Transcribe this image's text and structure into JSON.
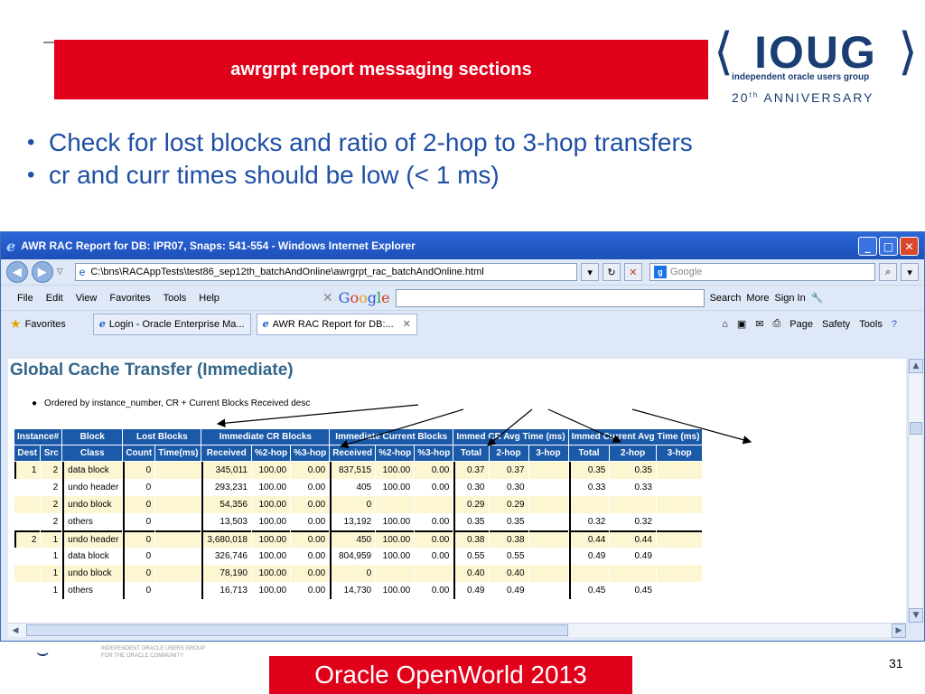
{
  "slide": {
    "title": "awrgrpt report messaging sections",
    "bullets": [
      "Check for lost blocks and ratio of 2-hop to 3-hop transfers",
      "cr and curr times should be low (< 1 ms)"
    ],
    "logo": {
      "wordmark": "IOUG",
      "subtitle": "independent oracle users group",
      "anniversary_num": "20",
      "anniversary_sup": "th",
      "anniversary_word": "ANNIVERSARY"
    },
    "footer_logo_text": [
      "INDEPENDENT ORACLE USERS GROUP",
      "FOR THE ORACLE COMMUNITY"
    ],
    "event_banner": "Oracle OpenWorld 2013",
    "page_number": "31"
  },
  "window": {
    "title": "AWR RAC Report for DB: IPR07, Snaps: 541-554 - Windows Internet Explorer",
    "address": "C:\\bns\\RACAppTests\\test86_sep12th_batchAndOnline\\awrgrpt_rac_batchAndOnline.html",
    "search_placeholder": "Google",
    "menu": [
      "File",
      "Edit",
      "View",
      "Favorites",
      "Tools",
      "Help"
    ],
    "google_toolbar": {
      "search_label": "Search",
      "more_label": "More",
      "signin_label": "Sign In"
    },
    "favorites_label": "Favorites",
    "tabs": [
      {
        "label": "Login - Oracle Enterprise Ma..."
      },
      {
        "label": "AWR RAC Report for DB:..."
      }
    ],
    "commands": [
      "Page",
      "Safety",
      "Tools"
    ]
  },
  "report": {
    "title": "Global Cache Transfer (Immediate)",
    "note": "Ordered by instance_number, CR + Current Blocks Received desc",
    "header_groups": [
      {
        "label": "Instance#",
        "span": 2
      },
      {
        "label": "Block",
        "span": 1
      },
      {
        "label": "Lost Blocks",
        "span": 2
      },
      {
        "label": "Immediate CR Blocks",
        "span": 3
      },
      {
        "label": "Immediate Current Blocks",
        "span": 3
      },
      {
        "label": "Immed CR Avg Time (ms)",
        "span": 3
      },
      {
        "label": "Immed Current Avg Time (ms)",
        "span": 3
      }
    ],
    "columns": [
      "Dest",
      "Src",
      "Class",
      "Count",
      "Time(ms)",
      "Received",
      "%2-hop",
      "%3-hop",
      "Received",
      "%2-hop",
      "%3-hop",
      "Total",
      "2-hop",
      "3-hop",
      "Total",
      "2-hop",
      "3-hop"
    ],
    "rows": [
      [
        "1",
        "2",
        "data block",
        "0",
        "",
        "345,011",
        "100.00",
        "0.00",
        "837,515",
        "100.00",
        "0.00",
        "0.37",
        "0.37",
        "",
        "0.35",
        "0.35",
        ""
      ],
      [
        "",
        "2",
        "undo header",
        "0",
        "",
        "293,231",
        "100.00",
        "0.00",
        "405",
        "100.00",
        "0.00",
        "0.30",
        "0.30",
        "",
        "0.33",
        "0.33",
        ""
      ],
      [
        "",
        "2",
        "undo block",
        "0",
        "",
        "54,356",
        "100.00",
        "0.00",
        "0",
        "",
        "",
        "0.29",
        "0.29",
        "",
        "",
        "",
        ""
      ],
      [
        "",
        "2",
        "others",
        "0",
        "",
        "13,503",
        "100.00",
        "0.00",
        "13,192",
        "100.00",
        "0.00",
        "0.35",
        "0.35",
        "",
        "0.32",
        "0.32",
        ""
      ],
      [
        "2",
        "1",
        "undo header",
        "0",
        "",
        "3,680,018",
        "100.00",
        "0.00",
        "450",
        "100.00",
        "0.00",
        "0.38",
        "0.38",
        "",
        "0.44",
        "0.44",
        ""
      ],
      [
        "",
        "1",
        "data block",
        "0",
        "",
        "326,746",
        "100.00",
        "0.00",
        "804,959",
        "100.00",
        "0.00",
        "0.55",
        "0.55",
        "",
        "0.49",
        "0.49",
        ""
      ],
      [
        "",
        "1",
        "undo block",
        "0",
        "",
        "78,190",
        "100.00",
        "0.00",
        "0",
        "",
        "",
        "0.40",
        "0.40",
        "",
        "",
        "",
        ""
      ],
      [
        "",
        "1",
        "others",
        "0",
        "",
        "16,713",
        "100.00",
        "0.00",
        "14,730",
        "100.00",
        "0.00",
        "0.49",
        "0.49",
        "",
        "0.45",
        "0.45",
        ""
      ]
    ]
  },
  "colors": {
    "title_red": "#e0001a",
    "bullet_blue": "#1f4fa6",
    "report_title": "#33668a",
    "table_header": "#1a5aa8",
    "row_highlight": "#fdf6d3",
    "logo_navy": "#1a3e73"
  }
}
